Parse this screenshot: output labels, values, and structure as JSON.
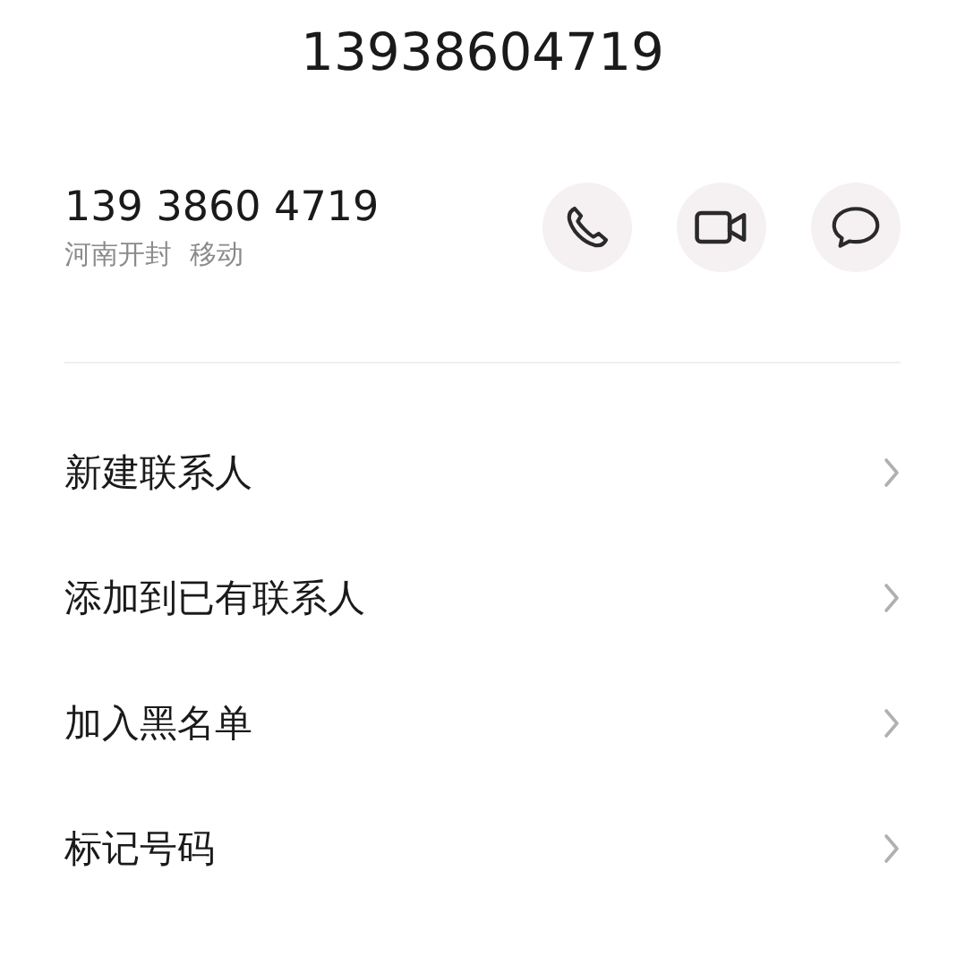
{
  "title": "13938604719",
  "contact": {
    "number": "139 3860 4719",
    "location": "河南开封",
    "carrier": "移动"
  },
  "actions": [
    {
      "kind": "call"
    },
    {
      "kind": "video"
    },
    {
      "kind": "message"
    }
  ],
  "menu": [
    {
      "label": "新建联系人"
    },
    {
      "label": "添加到已有联系人"
    },
    {
      "label": "加入黑名单"
    },
    {
      "label": "标记号码"
    }
  ]
}
